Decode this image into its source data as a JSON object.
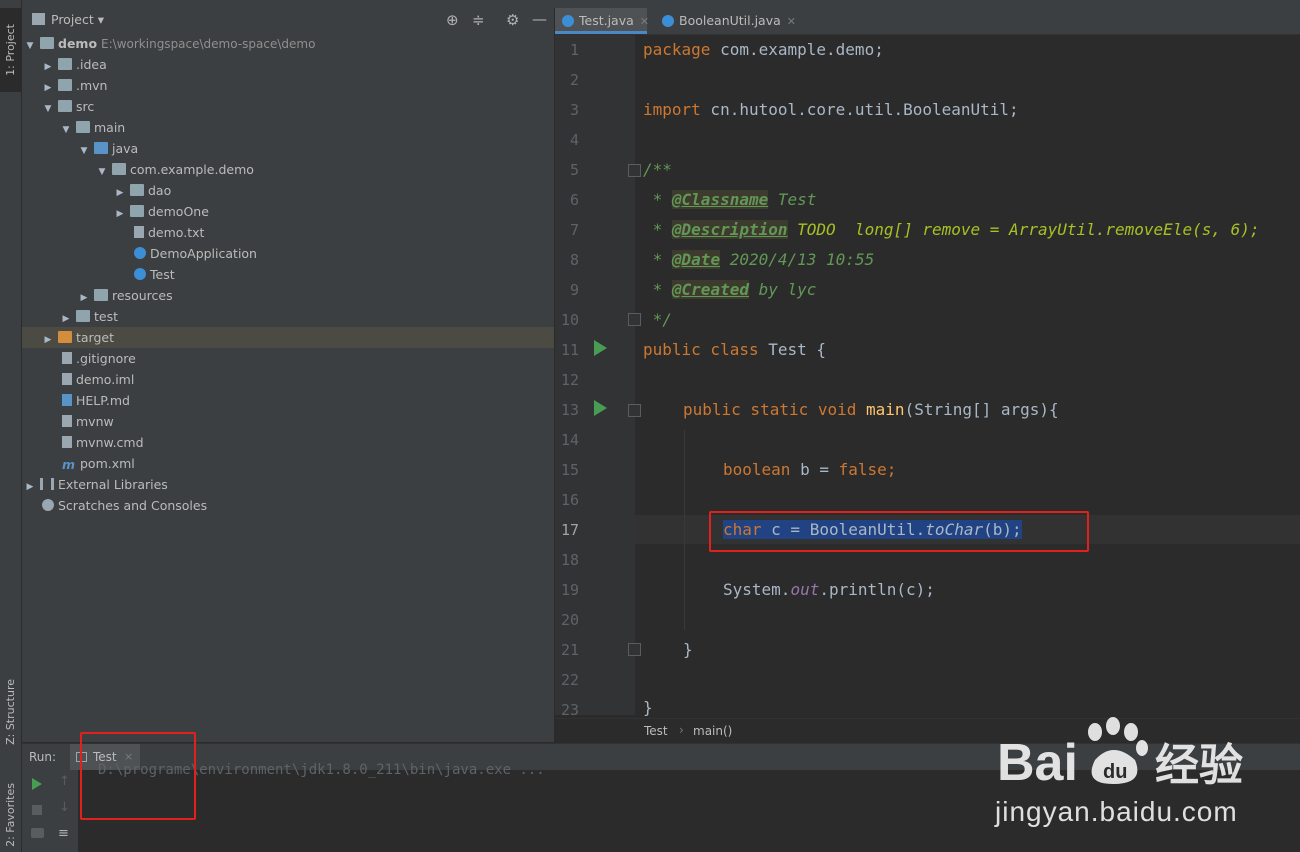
{
  "left_strip": {
    "project_tab": "1: Project",
    "structure_tab": "Z: Structure",
    "favorites_tab": "2: Favorites"
  },
  "project_header": {
    "title": "Project",
    "dropdown": "▾"
  },
  "tree": [
    {
      "label": "demo",
      "path": "E:\\workingspace\\demo-space\\demo"
    },
    {
      "label": ".idea"
    },
    {
      "label": ".mvn"
    },
    {
      "label": "src"
    },
    {
      "label": "main"
    },
    {
      "label": "java"
    },
    {
      "label": "com.example.demo"
    },
    {
      "label": "dao"
    },
    {
      "label": "demoOne"
    },
    {
      "label": "demo.txt"
    },
    {
      "label": "DemoApplication"
    },
    {
      "label": "Test"
    },
    {
      "label": "resources"
    },
    {
      "label": "test"
    },
    {
      "label": "target"
    },
    {
      "label": ".gitignore"
    },
    {
      "label": "demo.iml"
    },
    {
      "label": "HELP.md"
    },
    {
      "label": "mvnw"
    },
    {
      "label": "mvnw.cmd"
    },
    {
      "label": "pom.xml"
    },
    {
      "label": "External Libraries"
    },
    {
      "label": "Scratches and Consoles"
    }
  ],
  "editor_tabs": [
    {
      "label": "Test.java"
    },
    {
      "label": "BooleanUtil.java"
    }
  ],
  "line_numbers": [
    "1",
    "2",
    "3",
    "4",
    "5",
    "6",
    "7",
    "8",
    "9",
    "10",
    "11",
    "12",
    "13",
    "14",
    "15",
    "16",
    "17",
    "18",
    "19",
    "20",
    "21",
    "22",
    "23"
  ],
  "code": {
    "l1_kw": "package",
    "l1_rest": " com.example.demo;",
    "l3_kw": "import",
    "l3_rest": " cn.hutool.core.util.BooleanUtil;",
    "l5": "/**",
    "l6_star": " * ",
    "l6_tag": "@Classname",
    "l6_rest": " Test",
    "l7_star": " * ",
    "l7_tag": "@Description",
    "l7_todo": " TODO  long[] remove = ArrayUtil.removeEle(s, 6);",
    "l8_star": " * ",
    "l8_tag": "@Date",
    "l8_rest": " 2020/4/13 10:55",
    "l9_star": " * ",
    "l9_tag": "@Created",
    "l9_rest": " by lyc",
    "l10": " */",
    "l11_kw": "public class",
    "l11_rest": " Test {",
    "l13_kw": "public static void",
    "l13_fn": " main",
    "l13_rest": "(String[] args){",
    "l15_kw": "boolean",
    "l15_mid": " b = ",
    "l15_val": "false",
    "l15_end": ";",
    "l17_kw": "char",
    "l17_mid": " c = BooleanUtil.",
    "l17_fn": "toChar",
    "l17_rest": "(b);",
    "l19_a": "System.",
    "l19_out": "out",
    "l19_b": ".println(c);",
    "l21": "}",
    "l23": "}"
  },
  "breadcrumb": {
    "cls": "Test",
    "sep": "›",
    "method": "main()"
  },
  "run": {
    "label": "Run:",
    "tab": "Test",
    "close": "×",
    "output": "D:\\programe\\environment\\jdk1.8.0_211\\bin\\java.exe ..."
  },
  "watermark": {
    "domain": "jingyan.baidu.com"
  }
}
